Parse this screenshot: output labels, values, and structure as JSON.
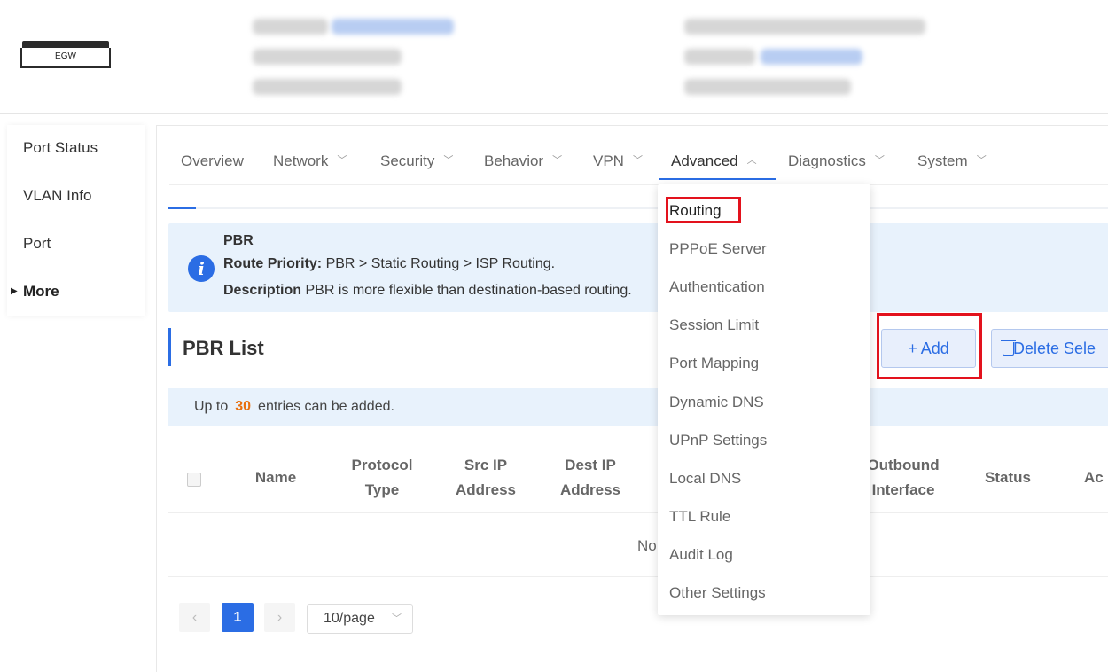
{
  "device": {
    "label": "EGW"
  },
  "sidebar": {
    "items": [
      {
        "label": "Port Status"
      },
      {
        "label": "VLAN Info"
      },
      {
        "label": "Port"
      },
      {
        "label": "More"
      }
    ]
  },
  "nav": {
    "tabs": [
      {
        "label": "Overview"
      },
      {
        "label": "Network"
      },
      {
        "label": "Security"
      },
      {
        "label": "Behavior"
      },
      {
        "label": "VPN"
      },
      {
        "label": "Advanced"
      },
      {
        "label": "Diagnostics"
      },
      {
        "label": "System"
      }
    ],
    "active": "Advanced"
  },
  "info": {
    "title": "PBR",
    "priority_label": "Route Priority:",
    "priority_text": "PBR > Static Routing > ISP Routing.",
    "desc_label": "Description",
    "desc_text": "PBR is more flexible than destination-based routing."
  },
  "list": {
    "title": "PBR List",
    "add_label": "+ Add",
    "delete_label": "Delete Sele"
  },
  "limit": {
    "prefix": "Up to",
    "count": "30",
    "suffix": "entries can be added."
  },
  "table": {
    "headers": {
      "name": "Name",
      "protocol_1": "Protocol",
      "protocol_2": "Type",
      "src_1": "Src IP",
      "src_2": "Address",
      "dest_1": "Dest IP",
      "dest_2": "Address",
      "outbound_1": "Outbound",
      "outbound_2": "Interface",
      "status": "Status",
      "action": "Ac"
    },
    "empty_text": "No"
  },
  "pagination": {
    "prev": "‹",
    "current": "1",
    "next": "›",
    "page_size": "10/page"
  },
  "dropdown": {
    "items": [
      {
        "label": "Routing"
      },
      {
        "label": "PPPoE Server"
      },
      {
        "label": "Authentication"
      },
      {
        "label": "Session Limit"
      },
      {
        "label": "Port Mapping"
      },
      {
        "label": "Dynamic DNS"
      },
      {
        "label": "UPnP Settings"
      },
      {
        "label": "Local DNS"
      },
      {
        "label": "TTL Rule"
      },
      {
        "label": "Audit Log"
      },
      {
        "label": "Other Settings"
      }
    ]
  },
  "colors": {
    "accent": "#2b6de4",
    "highlight": "#e3121d",
    "count": "#e8700f"
  }
}
